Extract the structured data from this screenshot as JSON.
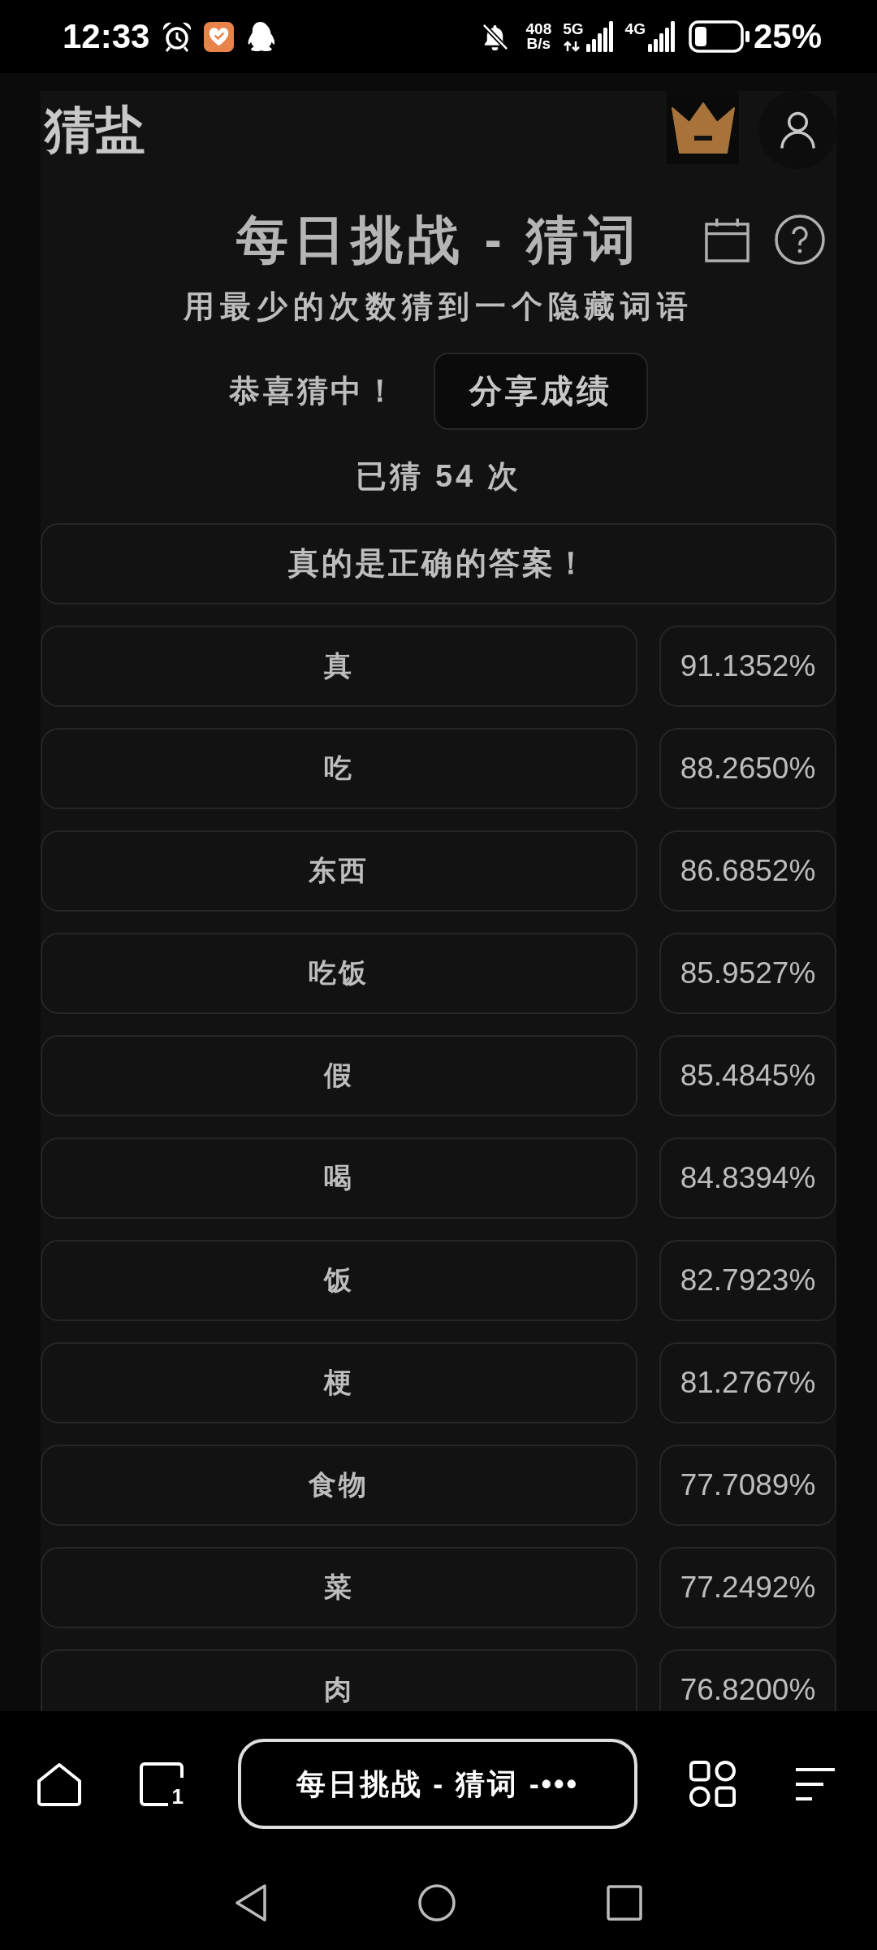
{
  "status_bar": {
    "time": "12:33",
    "network_speed": {
      "value": "408",
      "unit": "B/s"
    },
    "signals": [
      {
        "label": "5G",
        "transferring": true
      },
      {
        "label": "4G",
        "transferring": false
      }
    ],
    "battery": "25%"
  },
  "header": {
    "logo": "猜盐"
  },
  "challenge": {
    "title": "每日挑战 - 猜词",
    "subtitle": "用最少的次数猜到一个隐藏词语",
    "result_message": "恭喜猜中！",
    "share_button": "分享成绩",
    "guess_count": "已猜 54 次",
    "answer_banner": "真的是正确的答案！"
  },
  "guesses": [
    {
      "word": "真",
      "similarity": "91.1352%"
    },
    {
      "word": "吃",
      "similarity": "88.2650%"
    },
    {
      "word": "东西",
      "similarity": "86.6852%"
    },
    {
      "word": "吃饭",
      "similarity": "85.9527%"
    },
    {
      "word": "假",
      "similarity": "85.4845%"
    },
    {
      "word": "喝",
      "similarity": "84.8394%"
    },
    {
      "word": "饭",
      "similarity": "82.7923%"
    },
    {
      "word": "梗",
      "similarity": "81.2767%"
    },
    {
      "word": "食物",
      "similarity": "77.7089%"
    },
    {
      "word": "菜",
      "similarity": "77.2492%"
    },
    {
      "word": "肉",
      "similarity": "76.8200%"
    }
  ],
  "browser_bar": {
    "tab_count": "1",
    "address": "每日挑战 - 猜词 -•••"
  }
}
